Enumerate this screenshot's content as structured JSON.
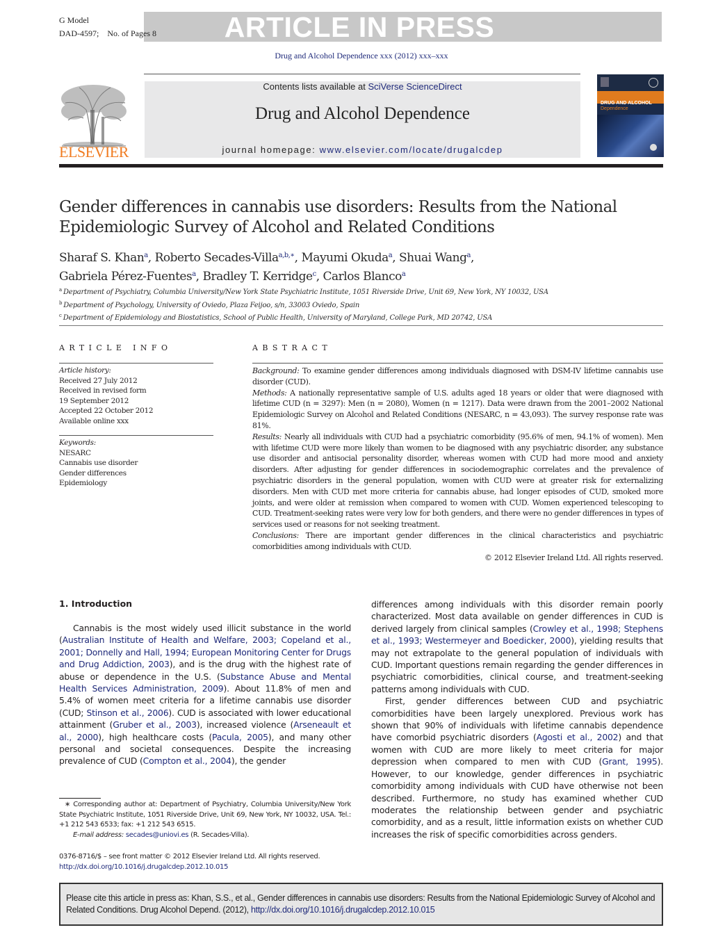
{
  "banner": {
    "model_label": "G Model",
    "doc_id": "DAD-4597;",
    "pages_label": "No. of Pages 8",
    "status": "ARTICLE IN PRESS",
    "journal_ref": "Drug and Alcohol Dependence xxx (2012) xxx–xxx"
  },
  "header": {
    "publisher_logo_text": "ELSEVIER",
    "contents_prefix": "Contents lists available at ",
    "contents_link": "SciVerse ScienceDirect",
    "journal_title": "Drug and Alcohol Dependence",
    "homepage_prefix": "journal homepage: ",
    "homepage_link": "www.elsevier.com/locate/drugalcdep",
    "cover_title_line1": "DRUG AND ALCOHOL",
    "cover_title_line2": "Dependence",
    "colors": {
      "publisher_orange": "#f07c22",
      "link_blue": "#1f2a7a",
      "cover_band": "#e07b1e",
      "cover_bg": "#1a2a4a"
    }
  },
  "article": {
    "title": "Gender differences in cannabis use disorders: Results from the National Epidemiologic Survey of Alcohol and Related Conditions",
    "authors": [
      {
        "name": "Sharaf S. Khan",
        "sup": "a",
        "sep": ", "
      },
      {
        "name": "Roberto Secades-Villa",
        "sup": "a,b,∗",
        "sep": ", "
      },
      {
        "name": "Mayumi Okuda",
        "sup": "a",
        "sep": ", "
      },
      {
        "name": "Shuai Wang",
        "sup": "a",
        "sep": ","
      },
      {
        "name": "Gabriela Pérez-Fuentes",
        "sup": "a",
        "sep": ", "
      },
      {
        "name": "Bradley T. Kerridge",
        "sup": "c",
        "sep": ", "
      },
      {
        "name": "Carlos Blanco",
        "sup": "a",
        "sep": ""
      }
    ],
    "affiliations": [
      {
        "key": "a",
        "text": "Department of Psychiatry, Columbia University/New York State Psychiatric Institute, 1051 Riverside Drive, Unit 69, New York, NY 10032, USA"
      },
      {
        "key": "b",
        "text": "Department of Psychology, University of Oviedo, Plaza Feijoo, s/n, 33003 Oviedo, Spain"
      },
      {
        "key": "c",
        "text": "Department of Epidemiology and Biostatistics, School of Public Health, University of Maryland, College Park, MD 20742, USA"
      }
    ]
  },
  "article_info": {
    "heading": "ARTICLE INFO",
    "history_label": "Article history:",
    "history": [
      "Received 27 July 2012",
      "Received in revised form",
      "19 September 2012",
      "Accepted 22 October 2012",
      "Available online xxx"
    ],
    "keywords_label": "Keywords:",
    "keywords": [
      "NESARC",
      "Cannabis use disorder",
      "Gender differences",
      "Epidemiology"
    ]
  },
  "abstract": {
    "heading": "ABSTRACT",
    "sections": [
      {
        "label": "Background:",
        "text": " To examine gender differences among individuals diagnosed with DSM-IV lifetime cannabis use disorder (CUD)."
      },
      {
        "label": "Methods:",
        "text": " A nationally representative sample of U.S. adults aged 18 years or older that were diagnosed with lifetime CUD (n = 3297): Men (n = 2080), Women (n = 1217). Data were drawn from the 2001–2002 National Epidemiologic Survey on Alcohol and Related Conditions (NESARC, n = 43,093). The survey response rate was 81%."
      },
      {
        "label": "Results:",
        "text": " Nearly all individuals with CUD had a psychiatric comorbidity (95.6% of men, 94.1% of women). Men with lifetime CUD were more likely than women to be diagnosed with any psychiatric disorder, any substance use disorder and antisocial personality disorder, whereas women with CUD had more mood and anxiety disorders. After adjusting for gender differences in sociodemographic correlates and the prevalence of psychiatric disorders in the general population, women with CUD were at greater risk for externalizing disorders. Men with CUD met more criteria for cannabis abuse, had longer episodes of CUD, smoked more joints, and were older at remission when compared to women with CUD. Women experienced telescoping to CUD. Treatment-seeking rates were very low for both genders, and there were no gender differences in types of services used or reasons for not seeking treatment."
      },
      {
        "label": "Conclusions:",
        "text": " There are important gender differences in the clinical characteristics and psychiatric comorbidities among individuals with CUD."
      }
    ],
    "copyright": "© 2012 Elsevier Ireland Ltd. All rights reserved."
  },
  "body": {
    "section_heading": "1.  Introduction",
    "left_paragraph": [
      {
        "t": "Cannabis is the most widely used illicit substance in the world ("
      },
      {
        "l": "Australian Institute of Health and Welfare, 2003; Copeland et al., 2001; Donnelly and Hall, 1994; European Monitoring Center for Drugs and Drug Addiction, 2003"
      },
      {
        "t": "), and is the drug with the highest rate of abuse or dependence in the U.S. ("
      },
      {
        "l": "Substance Abuse and Mental Health Services Administration, 2009"
      },
      {
        "t": "). About 11.8% of men and 5.4% of women meet criteria for a lifetime cannabis use disorder (CUD; "
      },
      {
        "l": "Stinson et al., 2006"
      },
      {
        "t": "). CUD is associated with lower educational attainment ("
      },
      {
        "l": "Gruber et al., 2003"
      },
      {
        "t": "), increased violence ("
      },
      {
        "l": "Arseneault et al., 2000"
      },
      {
        "t": "), high healthcare costs ("
      },
      {
        "l": "Pacula, 2005"
      },
      {
        "t": "), and many other personal and societal consequences. Despite the increasing prevalence of CUD ("
      },
      {
        "l": "Compton et al., 2004"
      },
      {
        "t": "), the gender"
      }
    ],
    "right_paragraph1": [
      {
        "t": "differences among individuals with this disorder remain poorly characterized. Most data available on gender differences in CUD is derived largely from clinical samples ("
      },
      {
        "l": "Crowley et al., 1998; Stephens et al., 1993; Westermeyer and Boedicker, 2000"
      },
      {
        "t": "), yielding results that may not extrapolate to the general population of individuals with CUD. Important questions remain regarding the gender differences in psychiatric comorbidities, clinical course, and treatment-seeking patterns among individuals with CUD."
      }
    ],
    "right_paragraph2": [
      {
        "t": "First, gender differences between CUD and psychiatric comorbidities have been largely unexplored. Previous work has shown that 90% of individuals with lifetime cannabis dependence have comorbid psychiatric disorders ("
      },
      {
        "l": "Agosti et al., 2002"
      },
      {
        "t": ") and that women with CUD are more likely to meet criteria for major depression when compared to men with CUD ("
      },
      {
        "l": "Grant, 1995"
      },
      {
        "t": "). However, to our knowledge, gender differences in psychiatric comorbidity among individuals with CUD have otherwise not been described. Furthermore, no study has examined whether CUD moderates the relationship between gender and psychiatric comorbidity, and as a result, little information exists on whether CUD increases the risk of specific comorbidities across genders."
      }
    ]
  },
  "footnotes": {
    "corresponding": "∗ Corresponding author at: Department of Psychiatry, Columbia University/New York State Psychiatric Institute, 1051 Riverside Drive, Unit 69, New York, NY 10032, USA. Tel.: +1 212 543 6533; fax: +1 212 543 6515.",
    "email_label": "E-mail address:",
    "email": "secades@uniovi.es",
    "email_suffix": " (R. Secades-Villa).",
    "issn_line": "0376-8716/$ – see front matter © 2012 Elsevier Ireland Ltd. All rights reserved.",
    "doi": "http://dx.doi.org/10.1016/j.drugalcdep.2012.10.015"
  },
  "cite_box": {
    "text": "Please cite this article in press as: Khan, S.S., et al., Gender differences in cannabis use disorders: Results from the National Epidemiologic Survey of Alcohol and Related Conditions. Drug Alcohol Depend. (2012), ",
    "doi": "http://dx.doi.org/10.1016/j.drugalcdep.2012.10.015"
  }
}
